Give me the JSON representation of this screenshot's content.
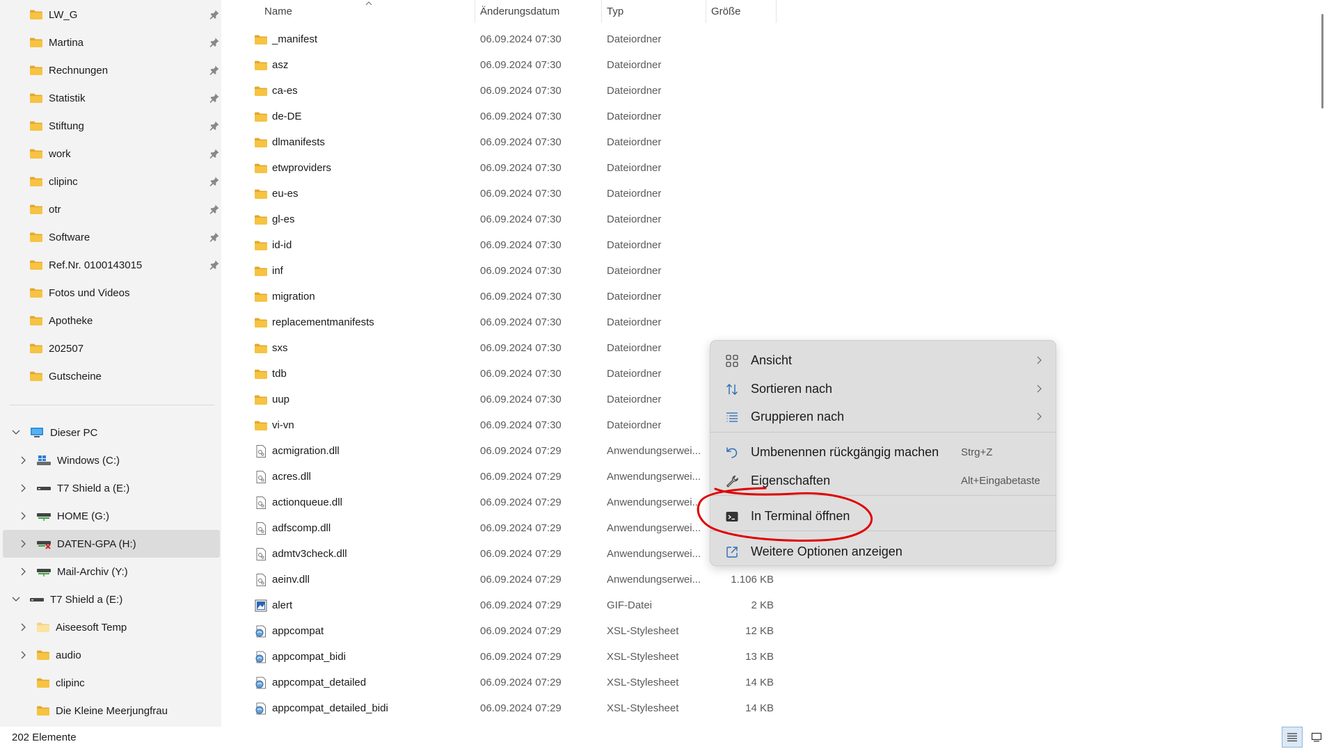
{
  "sidebar": {
    "quick_access": [
      {
        "label": "LW_G",
        "pinned": true
      },
      {
        "label": "Martina",
        "pinned": true
      },
      {
        "label": "Rechnungen",
        "pinned": true
      },
      {
        "label": "Statistik",
        "pinned": true
      },
      {
        "label": "Stiftung",
        "pinned": true
      },
      {
        "label": "work",
        "pinned": true
      },
      {
        "label": "clipinc",
        "pinned": true
      },
      {
        "label": "otr",
        "pinned": true
      },
      {
        "label": "Software",
        "pinned": true
      },
      {
        "label": "Ref.Nr. 0100143015",
        "pinned": true
      },
      {
        "label": "Fotos und Videos",
        "pinned": false
      },
      {
        "label": "Apotheke",
        "pinned": false
      },
      {
        "label": "202507",
        "pinned": false
      },
      {
        "label": "Gutscheine",
        "pinned": false
      }
    ],
    "this_pc": {
      "label": "Dieser PC",
      "drives": [
        {
          "label": "Windows (C:)",
          "icon": "windows-drive-icon"
        },
        {
          "label": "T7 Shield a (E:)",
          "icon": "drive-icon"
        },
        {
          "label": "HOME (G:)",
          "icon": "network-drive-icon"
        },
        {
          "label": "DATEN-GPA (H:)",
          "icon": "disconnected-network-drive-icon",
          "selected": true
        },
        {
          "label": "Mail-Archiv (Y:)",
          "icon": "network-drive-icon"
        }
      ]
    },
    "t7": {
      "label": "T7 Shield a (E:)",
      "children": [
        {
          "label": "Aiseesoft Temp",
          "expandable": true,
          "icon": "folder-light-icon"
        },
        {
          "label": "audio",
          "expandable": true,
          "icon": "folder-icon"
        },
        {
          "label": "clipinc",
          "expandable": false,
          "icon": "folder-icon"
        },
        {
          "label": "Die Kleine Meerjungfrau",
          "expandable": false,
          "icon": "folder-icon"
        }
      ]
    }
  },
  "columns": {
    "name": "Name",
    "date": "Änderungsdatum",
    "type": "Typ",
    "size": "Größe"
  },
  "files": [
    {
      "name": "_manifest",
      "date": "06.09.2024 07:30",
      "type": "Dateiordner",
      "size": "",
      "icon": "folder"
    },
    {
      "name": "asz",
      "date": "06.09.2024 07:30",
      "type": "Dateiordner",
      "size": "",
      "icon": "folder"
    },
    {
      "name": "ca-es",
      "date": "06.09.2024 07:30",
      "type": "Dateiordner",
      "size": "",
      "icon": "folder"
    },
    {
      "name": "de-DE",
      "date": "06.09.2024 07:30",
      "type": "Dateiordner",
      "size": "",
      "icon": "folder"
    },
    {
      "name": "dlmanifests",
      "date": "06.09.2024 07:30",
      "type": "Dateiordner",
      "size": "",
      "icon": "folder"
    },
    {
      "name": "etwproviders",
      "date": "06.09.2024 07:30",
      "type": "Dateiordner",
      "size": "",
      "icon": "folder"
    },
    {
      "name": "eu-es",
      "date": "06.09.2024 07:30",
      "type": "Dateiordner",
      "size": "",
      "icon": "folder"
    },
    {
      "name": "gl-es",
      "date": "06.09.2024 07:30",
      "type": "Dateiordner",
      "size": "",
      "icon": "folder"
    },
    {
      "name": "id-id",
      "date": "06.09.2024 07:30",
      "type": "Dateiordner",
      "size": "",
      "icon": "folder"
    },
    {
      "name": "inf",
      "date": "06.09.2024 07:30",
      "type": "Dateiordner",
      "size": "",
      "icon": "folder"
    },
    {
      "name": "migration",
      "date": "06.09.2024 07:30",
      "type": "Dateiordner",
      "size": "",
      "icon": "folder"
    },
    {
      "name": "replacementmanifests",
      "date": "06.09.2024 07:30",
      "type": "Dateiordner",
      "size": "",
      "icon": "folder"
    },
    {
      "name": "sxs",
      "date": "06.09.2024 07:30",
      "type": "Dateiordner",
      "size": "",
      "icon": "folder"
    },
    {
      "name": "tdb",
      "date": "06.09.2024 07:30",
      "type": "Dateiordner",
      "size": "",
      "icon": "folder"
    },
    {
      "name": "uup",
      "date": "06.09.2024 07:30",
      "type": "Dateiordner",
      "size": "",
      "icon": "folder"
    },
    {
      "name": "vi-vn",
      "date": "06.09.2024 07:30",
      "type": "Dateiordner",
      "size": "",
      "icon": "folder"
    },
    {
      "name": "acmigration.dll",
      "date": "06.09.2024 07:29",
      "type": "Anwendungserwei...",
      "size": "",
      "icon": "dll"
    },
    {
      "name": "acres.dll",
      "date": "06.09.2024 07:29",
      "type": "Anwendungserwei...",
      "size": "",
      "icon": "dll"
    },
    {
      "name": "actionqueue.dll",
      "date": "06.09.2024 07:29",
      "type": "Anwendungserwei...",
      "size": "",
      "icon": "dll"
    },
    {
      "name": "adfscomp.dll",
      "date": "06.09.2024 07:29",
      "type": "Anwendungserwei...",
      "size": "",
      "icon": "dll"
    },
    {
      "name": "admtv3check.dll",
      "date": "06.09.2024 07:29",
      "type": "Anwendungserwei...",
      "size": "",
      "icon": "dll"
    },
    {
      "name": "aeinv.dll",
      "date": "06.09.2024 07:29",
      "type": "Anwendungserwei...",
      "size": "1.106 KB",
      "icon": "dll"
    },
    {
      "name": "alert",
      "date": "06.09.2024 07:29",
      "type": "GIF-Datei",
      "size": "2 KB",
      "icon": "gif"
    },
    {
      "name": "appcompat",
      "date": "06.09.2024 07:29",
      "type": "XSL-Stylesheet",
      "size": "12 KB",
      "icon": "xsl"
    },
    {
      "name": "appcompat_bidi",
      "date": "06.09.2024 07:29",
      "type": "XSL-Stylesheet",
      "size": "13 KB",
      "icon": "xsl"
    },
    {
      "name": "appcompat_detailed",
      "date": "06.09.2024 07:29",
      "type": "XSL-Stylesheet",
      "size": "14 KB",
      "icon": "xsl"
    },
    {
      "name": "appcompat_detailed_bidi",
      "date": "06.09.2024 07:29",
      "type": "XSL-Stylesheet",
      "size": "14 KB",
      "icon": "xsl"
    }
  ],
  "status": {
    "count": "202 Elemente"
  },
  "context_menu": [
    {
      "label": "Ansicht",
      "icon": "view-grid-icon",
      "submenu": true,
      "shortcut": ""
    },
    {
      "label": "Sortieren nach",
      "icon": "sort-icon",
      "submenu": true,
      "shortcut": ""
    },
    {
      "label": "Gruppieren nach",
      "icon": "group-list-icon",
      "submenu": true,
      "shortcut": ""
    },
    {
      "label": "Umbenennen rückgängig machen",
      "icon": "undo-icon",
      "submenu": false,
      "shortcut": "Strg+Z"
    },
    {
      "label": "Eigenschaften",
      "icon": "wrench-icon",
      "submenu": false,
      "shortcut": "Alt+Eingabetaste"
    },
    {
      "label": "In Terminal öffnen",
      "icon": "terminal-icon",
      "submenu": false,
      "shortcut": ""
    },
    {
      "label": "Weitere Optionen anzeigen",
      "icon": "open-external-icon",
      "submenu": false,
      "shortcut": ""
    }
  ],
  "colors": {
    "folder": "#f6c342",
    "folder_dark": "#e3a82b",
    "selection": "#dcdcdc",
    "annotation": "#e00000"
  }
}
